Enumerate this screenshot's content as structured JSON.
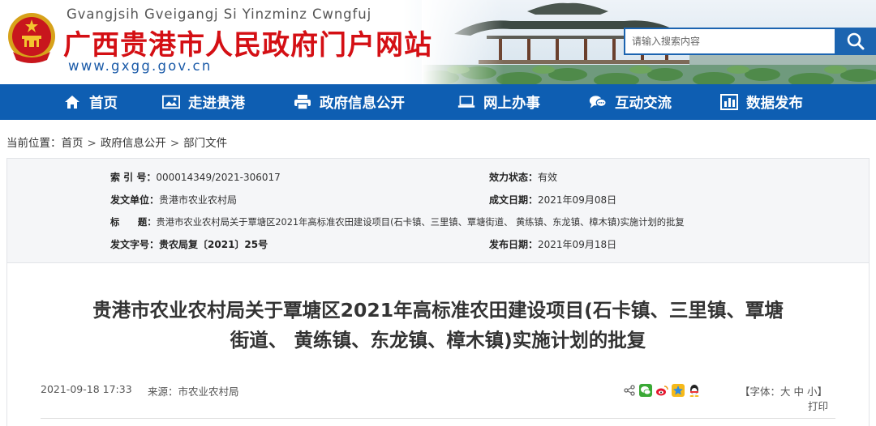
{
  "header": {
    "pinyin": "Gvangjsih Gveigangj Si Yinzminz Cwngfuj",
    "title": "广西贵港市人民政府门户网站",
    "url": "www.gxgg.gov.cn",
    "search_placeholder": "请输入搜索内容"
  },
  "nav": {
    "items": [
      {
        "label": "首页",
        "icon": "home-icon"
      },
      {
        "label": "走进贵港",
        "icon": "picture-icon"
      },
      {
        "label": "政府信息公开",
        "icon": "printer-icon"
      },
      {
        "label": "网上办事",
        "icon": "laptop-icon"
      },
      {
        "label": "互动交流",
        "icon": "chat-bubbles-icon"
      },
      {
        "label": "数据发布",
        "icon": "bar-chart-icon"
      }
    ]
  },
  "breadcrumb": {
    "prefix": "当前位置：",
    "items": [
      "首页",
      "政府信息公开",
      "部门文件"
    ],
    "separator": ">"
  },
  "info": {
    "index_label": "索 引 号：",
    "index_value": "000014349/2021-306017",
    "validity_label": "效力状态：",
    "validity_value": "有效",
    "issuer_label": "发文单位：",
    "issuer_value": "贵港市农业农村局",
    "created_label": "成文日期：",
    "created_value": "2021年09月08日",
    "subject_label": "标　　题：",
    "subject_value": "贵港市农业农村局关于覃塘区2021年高标准农田建设项目(石卡镇、三里镇、覃塘街道、 黄练镇、东龙镇、樟木镇)实施计划的批复",
    "docno_label": "发文字号：",
    "docno_value": "贵农局复〔2021〕25号",
    "published_label": "发布日期：",
    "published_value": "2021年09月18日"
  },
  "article": {
    "title_line1": "贵港市农业农村局关于覃塘区2021年高标准农田建设项目(石卡镇、三里镇、覃塘",
    "title_line2": "街道、 黄练镇、东龙镇、樟木镇)实施计划的批复",
    "datetime": "2021-09-18 17:33",
    "source_label": "来源：",
    "source_value": "市农业农村局",
    "font_size_open": "【字体：",
    "font_large": "大",
    "font_medium": "中",
    "font_small": "小",
    "font_size_close": "】",
    "print_label": "打印"
  },
  "colors": {
    "brand_red": "#d40f14",
    "nav_blue": "#0e5eb2",
    "search_blue": "#1c64b0"
  }
}
